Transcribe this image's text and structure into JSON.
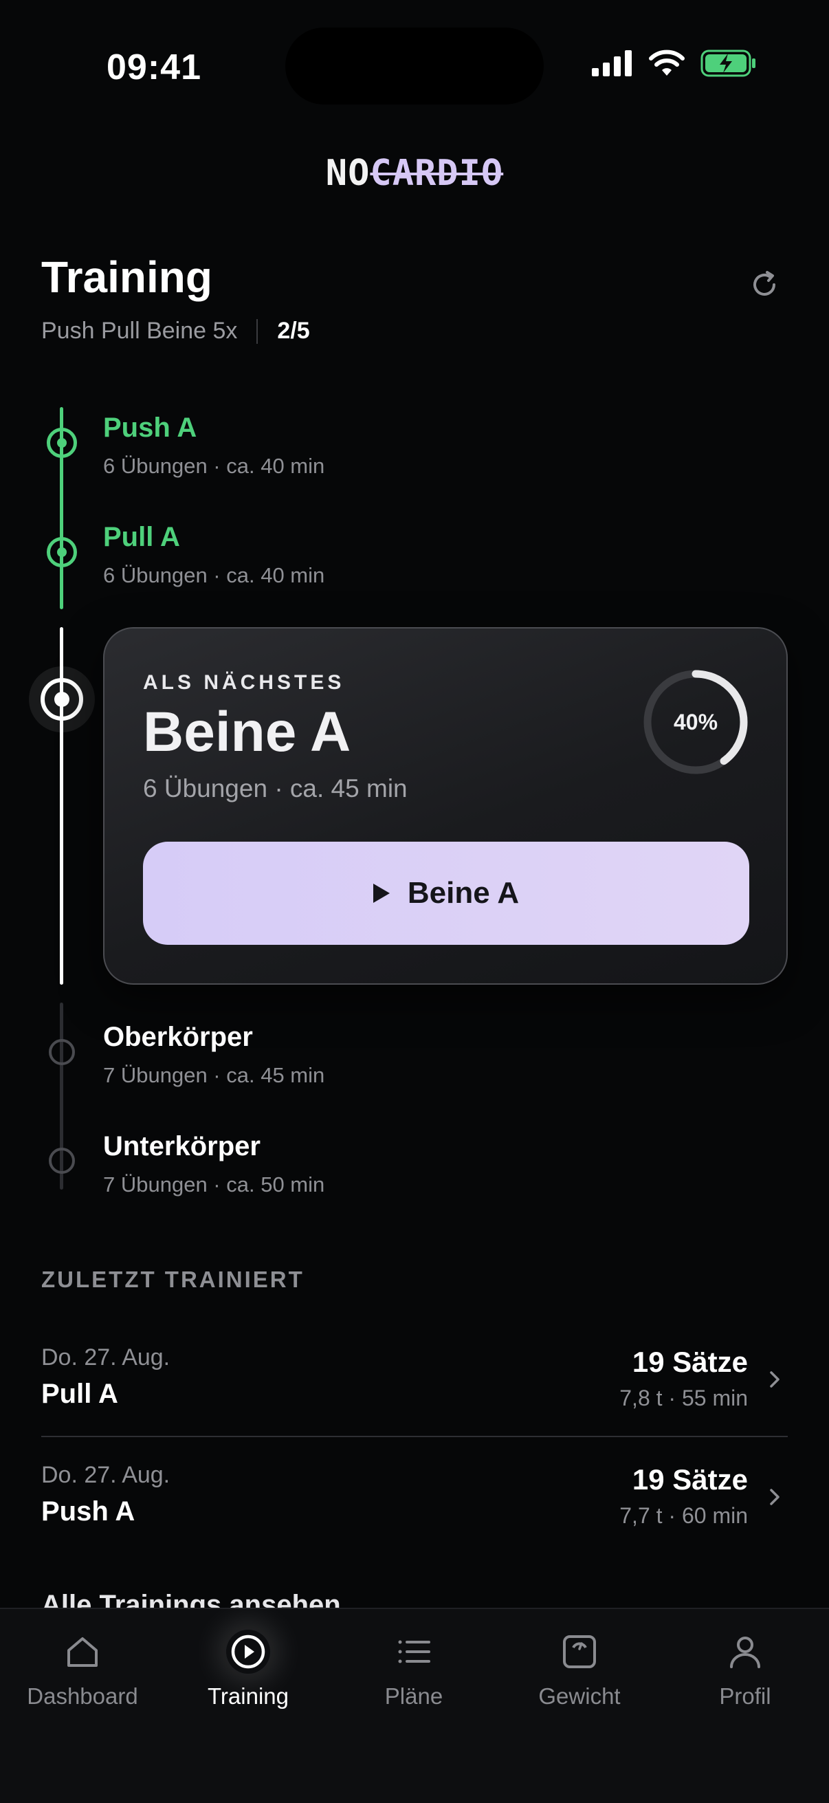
{
  "status_bar": {
    "time": "09:41"
  },
  "logo": {
    "prefix": "NO",
    "strike": "CARDIO"
  },
  "header": {
    "title": "Training",
    "plan": "Push Pull Beine 5x",
    "progress": "2/5"
  },
  "timeline": [
    {
      "name": "Push A",
      "meta": "6 Übungen · ca. 40 min",
      "state": "done"
    },
    {
      "name": "Pull A",
      "meta": "6 Übungen · ca. 40 min",
      "state": "done"
    },
    {
      "name": "Beine A",
      "meta": "6 Übungen · ca. 45 min",
      "state": "current"
    },
    {
      "name": "Oberkörper",
      "meta": "7 Übungen · ca. 45 min",
      "state": "todo"
    },
    {
      "name": "Unterkörper",
      "meta": "7 Übungen · ca. 50 min",
      "state": "todo"
    }
  ],
  "next_card": {
    "kicker": "ALS NÄCHSTES",
    "title": "Beine A",
    "meta": "6 Übungen · ca. 45 min",
    "progress_label": "40%",
    "progress_fraction": 0.4,
    "button_label": "Beine A"
  },
  "recent": {
    "section_title": "ZULETZT TRAINIERT",
    "items": [
      {
        "date": "Do. 27. Aug.",
        "name": "Pull A",
        "sets": "19 Sätze",
        "stats": "7,8 t · 55 min"
      },
      {
        "date": "Do. 27. Aug.",
        "name": "Push A",
        "sets": "19 Sätze",
        "stats": "7,7 t · 60 min"
      }
    ],
    "see_all": "Alle Trainings ansehen"
  },
  "tabs": [
    {
      "label": "Dashboard",
      "icon": "home-icon"
    },
    {
      "label": "Training",
      "icon": "play-circle-icon"
    },
    {
      "label": "Pläne",
      "icon": "list-icon"
    },
    {
      "label": "Gewicht",
      "icon": "scale-icon"
    },
    {
      "label": "Profil",
      "icon": "user-icon"
    }
  ],
  "colors": {
    "background": "#060708",
    "done": "#4ed07b",
    "accent": "#d6ccf7",
    "battery": "#4ed07b"
  }
}
